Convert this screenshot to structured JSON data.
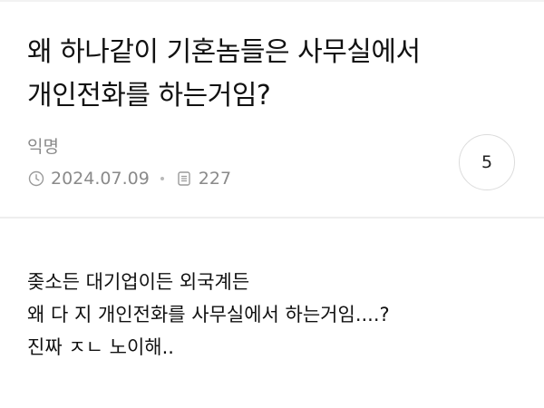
{
  "post": {
    "title": "왜 하나같이 기혼놈들은 사무실에서 개인전화를 하는거임?",
    "author": "익명",
    "date": "2024.07.09",
    "views": "227",
    "comment_count": "5",
    "body_lines": [
      "좆소든 대기업이든 외국계든",
      "왜 다 지 개인전화를 사무실에서 하는거임....?",
      "진짜 ㅈㄴ 노이해.."
    ]
  },
  "icons": {
    "date": "clock-icon",
    "views": "document-icon"
  },
  "colors": {
    "meta_text": "#8a8a8a",
    "divider": "#eeeeee",
    "circle_border": "#dcdcdc"
  }
}
